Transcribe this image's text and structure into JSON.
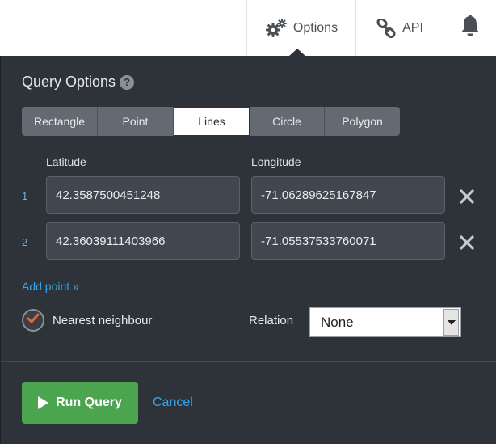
{
  "topbar": {
    "options_label": "Options",
    "api_label": "API",
    "options_icon": "gears-icon",
    "api_icon": "link-icon",
    "bell_icon": "bell-icon"
  },
  "panel": {
    "title": "Query Options",
    "help_icon": "?",
    "tabs": [
      {
        "label": "Rectangle",
        "active": false
      },
      {
        "label": "Point",
        "active": false
      },
      {
        "label": "Lines",
        "active": true
      },
      {
        "label": "Circle",
        "active": false
      },
      {
        "label": "Polygon",
        "active": false
      }
    ],
    "columns": {
      "latitude": "Latitude",
      "longitude": "Longitude"
    },
    "points": [
      {
        "index": "1",
        "latitude": "42.3587500451248",
        "longitude": "-71.06289625167847"
      },
      {
        "index": "2",
        "latitude": "42.36039111403966",
        "longitude": "-71.05537533760071"
      }
    ],
    "add_point": "Add point »",
    "nearest_neighbour": {
      "label": "Nearest neighbour",
      "checked": true
    },
    "relation": {
      "label": "Relation",
      "value": "None"
    },
    "run_button": "Run Query",
    "cancel": "Cancel"
  },
  "colors": {
    "panel_bg": "#2e3339",
    "accent_blue": "#3aa3e3",
    "run_green": "#4aa54e",
    "check_orange": "#e8692d"
  }
}
